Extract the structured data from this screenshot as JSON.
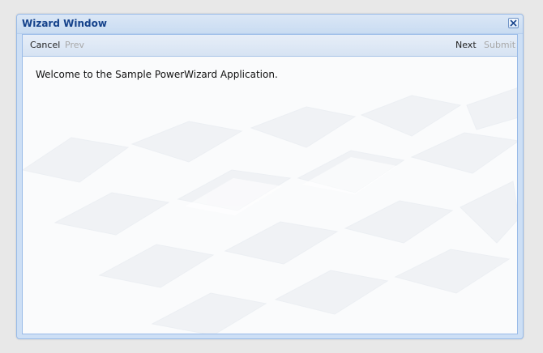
{
  "window": {
    "title": "Wizard Window",
    "close_icon": "close-icon"
  },
  "toolbar": {
    "cancel_label": "Cancel",
    "prev_label": "Prev",
    "next_label": "Next",
    "submit_label": "Submit"
  },
  "content": {
    "welcome_text": "Welcome to the Sample PowerWizard Application."
  },
  "colors": {
    "title_text": "#15428b",
    "window_border": "#99bbe8",
    "toolbar_background": "#dfe8f6",
    "disabled_text": "#a8a8a8"
  }
}
